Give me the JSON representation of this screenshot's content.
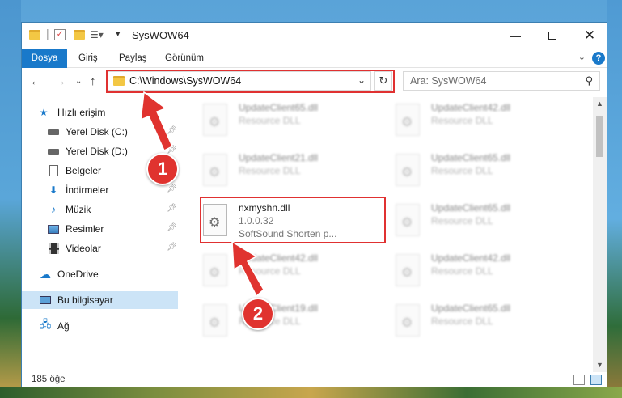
{
  "window": {
    "title": "SysWOW64"
  },
  "ribbon": {
    "tabs": [
      "Dosya",
      "Giriş",
      "Paylaş",
      "Görünüm"
    ]
  },
  "nav": {
    "address": "C:\\Windows\\SysWOW64",
    "search_placeholder": "Ara: SysWOW64"
  },
  "sidebar": {
    "items": [
      {
        "label": "Hızlı erişim",
        "icon": "star-icon"
      },
      {
        "label": "Yerel Disk (C:)",
        "icon": "drive-icon",
        "pinned": true
      },
      {
        "label": "Yerel Disk (D:)",
        "icon": "drive-icon",
        "pinned": true
      },
      {
        "label": "Belgeler",
        "icon": "document-icon",
        "pinned": true
      },
      {
        "label": "İndirmeler",
        "icon": "download-icon",
        "pinned": true
      },
      {
        "label": "Müzik",
        "icon": "music-icon",
        "pinned": true
      },
      {
        "label": "Resimler",
        "icon": "pictures-icon",
        "pinned": true
      },
      {
        "label": "Videolar",
        "icon": "video-icon",
        "pinned": true
      },
      {
        "label": "OneDrive",
        "icon": "cloud-icon"
      },
      {
        "label": "Bu bilgisayar",
        "icon": "computer-icon",
        "selected": true
      },
      {
        "label": "Ağ",
        "icon": "network-icon"
      }
    ]
  },
  "files": {
    "highlighted": {
      "name": "nxmyshn.dll",
      "version": "1.0.0.32",
      "description": "SoftSound Shorten p..."
    },
    "blurred": [
      {
        "name": "UpdateClient65.dll",
        "type": "Resource DLL"
      },
      {
        "name": "UpdateClient42.dll",
        "type": "Resource DLL"
      },
      {
        "name": "UpdateClient21.dll",
        "type": "Resource DLL"
      },
      {
        "name": "UpdateClient65.dll",
        "type": "Resource DLL"
      },
      {
        "name": "UpdateClient65.dll",
        "type": "Resource DLL"
      },
      {
        "name": "UpdateClient42.dll",
        "type": "Resource DLL"
      },
      {
        "name": "UpdateClient42.dll",
        "type": "Resource DLL"
      },
      {
        "name": "UpdateClient19.dll",
        "type": "Resource DLL"
      },
      {
        "name": "UpdateClient65.dll",
        "type": "Resource DLL"
      }
    ]
  },
  "status": {
    "count": "185 öğe"
  },
  "annotations": {
    "step1": "1",
    "step2": "2"
  },
  "colors": {
    "accent": "#1979ca",
    "highlight_box": "#e03131",
    "callout": "#e0332f",
    "selected_bg": "#cce4f7"
  }
}
